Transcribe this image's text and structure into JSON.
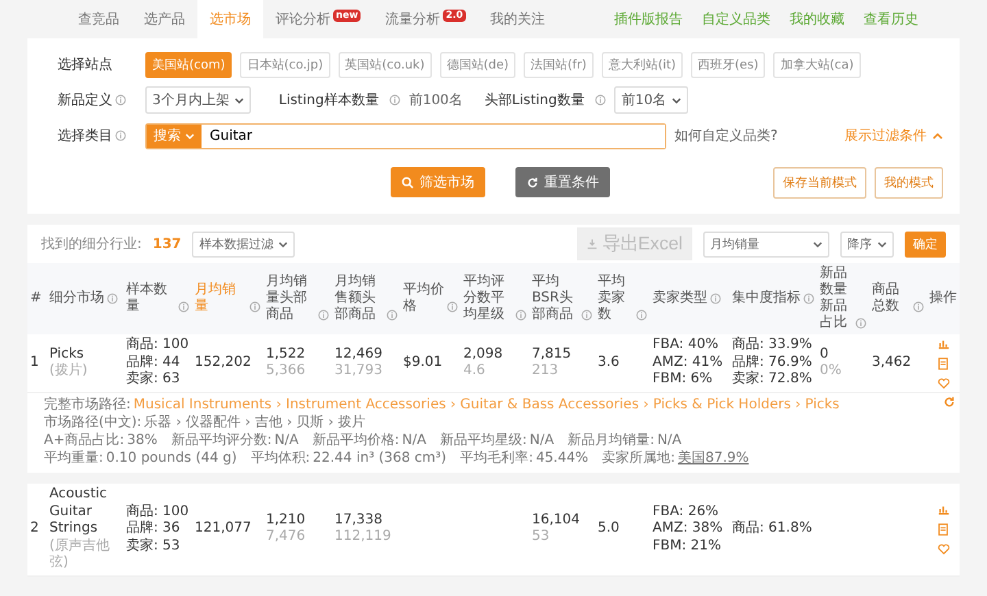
{
  "tabs": [
    {
      "label": "查竞品",
      "selected": false
    },
    {
      "label": "选产品",
      "selected": false
    },
    {
      "label": "选市场",
      "selected": true
    },
    {
      "label": "评论分析",
      "selected": false,
      "badge": "new"
    },
    {
      "label": "流量分析",
      "selected": false,
      "badge": "2.0"
    },
    {
      "label": "我的关注",
      "selected": false
    }
  ],
  "top_links": [
    "插件版报告",
    "自定义品类",
    "我的收藏",
    "查看历史"
  ],
  "filters": {
    "site_label": "选择站点",
    "sites": [
      {
        "label": "美国站(com)",
        "selected": true
      },
      {
        "label": "日本站(co.jp)",
        "selected": false
      },
      {
        "label": "英国站(co.uk)",
        "selected": false
      },
      {
        "label": "德国站(de)",
        "selected": false
      },
      {
        "label": "法国站(fr)",
        "selected": false
      },
      {
        "label": "意大利站(it)",
        "selected": false
      },
      {
        "label": "西班牙(es)",
        "selected": false
      },
      {
        "label": "加拿大站(ca)",
        "selected": false
      }
    ],
    "new_label": "新品定义",
    "new_value": "3个月内上架",
    "sample_label": "Listing样本数量",
    "sample_value": "前100名",
    "head_label": "头部Listing数量",
    "head_value": "前10名",
    "category_label": "选择类目",
    "search_mode": "搜索",
    "search_value": "Guitar",
    "custom_link": "如何自定义品类?",
    "toggle_filters": "展示过滤条件",
    "buttons": [
      {
        "label": "筛选市场",
        "kind": "primary"
      },
      {
        "label": "重置条件",
        "kind": "reset"
      }
    ],
    "mode_buttons": [
      "保存当前模式",
      "我的模式"
    ]
  },
  "results": {
    "found_label": "找到的细分行业:",
    "found_count": "137",
    "sample_filter": "样本数据过滤",
    "export": {
      "label": "导出Excel",
      "disabled": true
    },
    "sort_field": "月均销量",
    "sort_order": "降序",
    "confirm": "确定",
    "columns": [
      {
        "label": "#",
        "info": false,
        "sorted": false
      },
      {
        "label": "细分市场",
        "info": true,
        "sorted": false
      },
      {
        "label": "样本数量",
        "info": true,
        "sorted": false
      },
      {
        "label": "月均销量",
        "info": true,
        "sorted": true
      },
      {
        "label": "月均销量头部商品",
        "info": true,
        "sorted": false
      },
      {
        "label": "月均销售额头部商品",
        "info": true,
        "sorted": false
      },
      {
        "label": "平均价格",
        "info": true,
        "sorted": false
      },
      {
        "label": "平均评分数平均星级",
        "info": true,
        "sorted": false
      },
      {
        "label": "平均BSR头部商品",
        "info": true,
        "sorted": false
      },
      {
        "label": "平均卖家数",
        "info": true,
        "sorted": false
      },
      {
        "label": "卖家类型",
        "info": true,
        "sorted": false
      },
      {
        "label": "集中度指标",
        "info": true,
        "sorted": false
      },
      {
        "label": "新品数量新品占比",
        "info": true,
        "sorted": false
      },
      {
        "label": "商品总数",
        "info": true,
        "sorted": false
      },
      {
        "label": "操作",
        "info": false,
        "sorted": false
      }
    ],
    "rows": [
      {
        "index": "1",
        "market": "Picks",
        "market_cn": "(拨片)",
        "sample": [
          "商品: 100",
          "品牌: 44",
          "卖家: 63"
        ],
        "monthly_sales": "152,202",
        "top_sales": [
          "1,522",
          "5,366"
        ],
        "top_revenue": [
          "12,469",
          "31,793"
        ],
        "avg_price": "$9.01",
        "reviews": [
          "2,098",
          "4.6"
        ],
        "bsr": [
          "7,815",
          "213"
        ],
        "sellers": "3.6",
        "seller_types": [
          "FBA: 40%",
          "AMZ: 41%",
          "FBM: 6%"
        ],
        "concentration": [
          "商品: 33.9%",
          "品牌: 76.9%",
          "卖家: 72.8%"
        ],
        "new_products": [
          "0",
          "0%"
        ],
        "total": "3,462",
        "details": [
          [
            {
              "label": "完整市场路径:",
              "value": "Musical Instruments › Instrument Accessories › Guitar & Bass Accessories › Picks & Pick Holders › Picks",
              "kind": "path"
            }
          ],
          [
            {
              "label": "市场路径(中文):",
              "value": "乐器 › 仪器配件 › 吉他 › 贝斯 › 拨片",
              "kind": "plain"
            }
          ],
          [
            {
              "label": "A+商品占比:",
              "value": "38%",
              "kind": "plain"
            },
            {
              "label": "新品平均评分数:",
              "value": "N/A",
              "kind": "plain"
            },
            {
              "label": "新品平均价格:",
              "value": "N/A",
              "kind": "plain"
            },
            {
              "label": "新品平均星级:",
              "value": "N/A",
              "kind": "plain"
            },
            {
              "label": "新品月均销量:",
              "value": "N/A",
              "kind": "plain"
            }
          ],
          [
            {
              "label": "平均重量:",
              "value": "0.10 pounds (44 g)",
              "kind": "plain"
            },
            {
              "label": "平均体积:",
              "value": "22.44 in³ (368 cm³)",
              "kind": "plain"
            },
            {
              "label": "平均毛利率:",
              "value": "45.44%",
              "kind": "plain"
            },
            {
              "label": "卖家所属地:",
              "value": "美国87.9%",
              "kind": "link"
            }
          ]
        ]
      },
      {
        "index": "2",
        "market": "Acoustic Guitar Strings",
        "market_cn": "(原声吉他弦)",
        "sample": [
          "商品: 100",
          "品牌: 36",
          "卖家: 53"
        ],
        "monthly_sales": "121,077",
        "top_sales": [
          "1,210",
          "7,476"
        ],
        "top_revenue": [
          "17,338",
          "112,119"
        ],
        "bsr": [
          "16,104",
          "53"
        ],
        "sellers": "5.0",
        "seller_types": [
          "FBA: 26%",
          "AMZ: 38%",
          "FBM: 21%"
        ],
        "concentration": [
          "商品: 61.8%"
        ],
        "details": []
      }
    ]
  }
}
